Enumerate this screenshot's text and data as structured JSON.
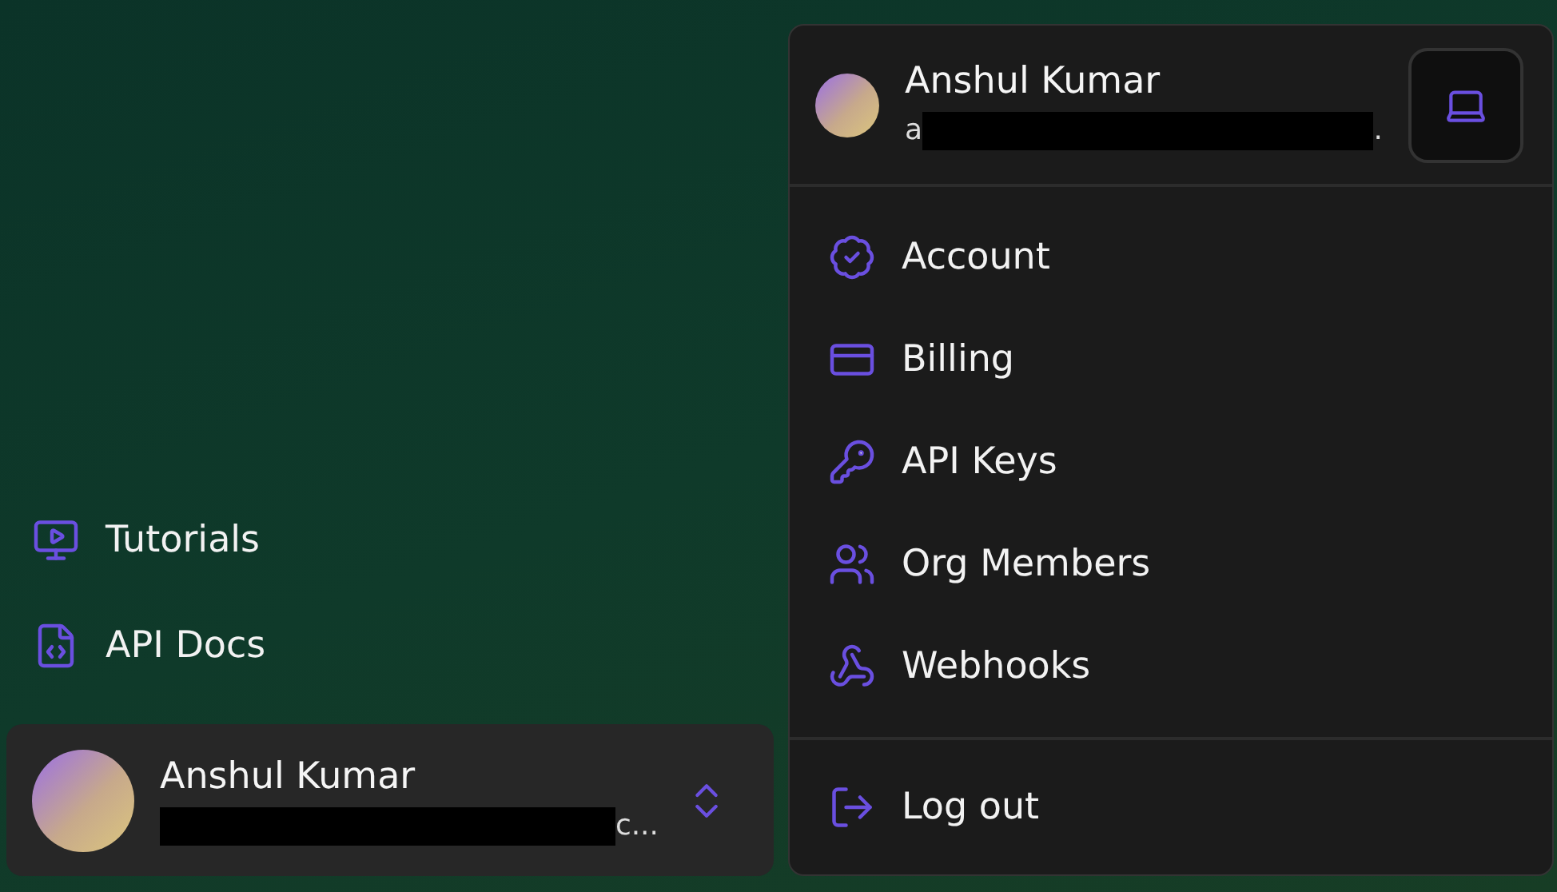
{
  "sidebar": {
    "links": [
      {
        "label": "Tutorials",
        "kind": "video"
      },
      {
        "label": "API Docs",
        "kind": "code"
      }
    ],
    "user": {
      "name": "Anshul Kumar",
      "email_suffix": "c..."
    }
  },
  "menu": {
    "user": {
      "name": "Anshul Kumar",
      "email_prefix": "a",
      "email_suffix": "."
    },
    "items": [
      {
        "label": "Account",
        "kind": "badge"
      },
      {
        "label": "Billing",
        "kind": "card"
      },
      {
        "label": "API Keys",
        "kind": "key"
      },
      {
        "label": "Org Members",
        "kind": "users"
      },
      {
        "label": "Webhooks",
        "kind": "webhook"
      }
    ],
    "footer": [
      {
        "label": "Log out",
        "kind": "logout"
      }
    ]
  }
}
